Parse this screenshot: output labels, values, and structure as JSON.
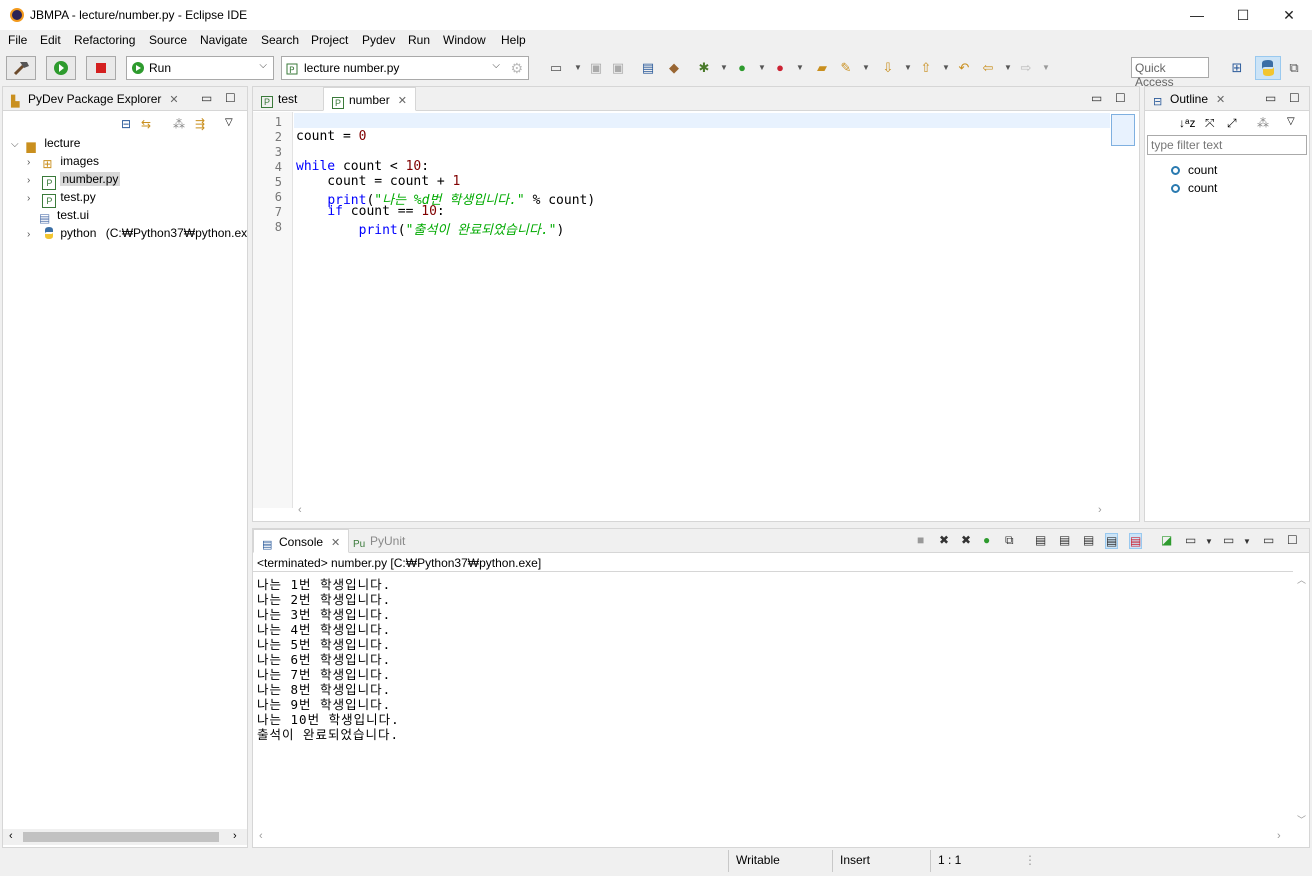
{
  "window": {
    "title": "JBMPA - lecture/number.py - Eclipse IDE",
    "minimize": "—",
    "maximize": "☐",
    "close": "✕"
  },
  "menu": [
    "File",
    "Edit",
    "Refactoring",
    "Source",
    "Navigate",
    "Search",
    "Project",
    "Pydev",
    "Run",
    "Window",
    "Help"
  ],
  "toolbar": {
    "run_config": "Run",
    "launch_target": "lecture number.py",
    "quick_access_placeholder": "Quick Access"
  },
  "explorer": {
    "tab_label": "PyDev Package Explorer",
    "tree": {
      "project": "lecture",
      "items": [
        {
          "label": "images",
          "type": "package",
          "selected": false
        },
        {
          "label": "number.py",
          "type": "python-file",
          "selected": true
        },
        {
          "label": "test.py",
          "type": "python-file",
          "selected": false
        },
        {
          "label": "test.ui",
          "type": "file",
          "selected": false
        }
      ],
      "interpreter": "python",
      "interpreter_path": "(C:₩Python37₩python.ex"
    }
  },
  "editor": {
    "tabs": [
      {
        "label": "test",
        "active": false
      },
      {
        "label": "number",
        "active": true
      }
    ],
    "line_numbers": [
      "1",
      "2",
      "3",
      "4",
      "5",
      "6",
      "7",
      "8"
    ]
  },
  "outline": {
    "tab_label": "Outline",
    "filter_placeholder": "type filter text",
    "items": [
      "count",
      "count"
    ]
  },
  "console": {
    "tabs": [
      {
        "label": "Console",
        "active": true
      },
      {
        "label": "PyUnit",
        "active": false
      }
    ],
    "header": "<terminated> number.py [C:₩Python37₩python.exe]",
    "lines": [
      "나는 1번 학생입니다.",
      "나는 2번 학생입니다.",
      "나는 3번 학생입니다.",
      "나는 4번 학생입니다.",
      "나는 5번 학생입니다.",
      "나는 6번 학생입니다.",
      "나는 7번 학생입니다.",
      "나는 8번 학생입니다.",
      "나는 9번 학생입니다.",
      "나는 10번 학생입니다.",
      "출석이 완료되었습니다."
    ]
  },
  "status": {
    "writable": "Writable",
    "insert": "Insert",
    "position": "1 : 1"
  },
  "colors": {
    "keyword": "#0000ff",
    "number": "#800000",
    "string": "#00aa00",
    "current_line": "#e8f2fe"
  },
  "code": {
    "l2_var": "count",
    "l2_op": " = ",
    "l2_num": "0",
    "l4_kw": "while",
    "l4_rest": " count < ",
    "l4_num": "10",
    "l4_end": ":",
    "l5_text": "    count = count + ",
    "l5_num": "1",
    "l6_indent": "    ",
    "l6_kw": "print",
    "l6_paren": "(",
    "l6_str": "\"나는 %d번 학생입니다.\"",
    "l6_rest": " % count)",
    "l7_indent": "    ",
    "l7_kw": "if",
    "l7_rest": " count == ",
    "l7_num": "10",
    "l7_end": ":",
    "l8_indent": "        ",
    "l8_kw": "print",
    "l8_paren": "(",
    "l8_str": "\"출석이 완료되었습니다.\"",
    "l8_end": ")"
  }
}
